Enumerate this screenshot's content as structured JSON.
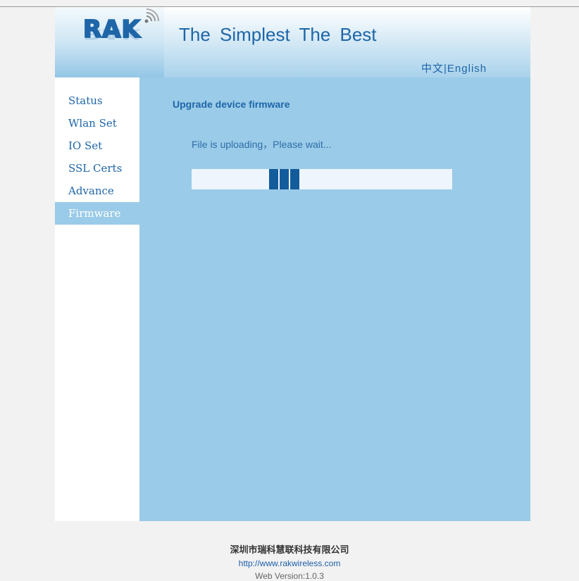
{
  "header": {
    "logo_text": "RAK",
    "slogan": "The Simplest The Best",
    "lang_zh": "中文",
    "lang_sep": "|",
    "lang_en": "English"
  },
  "sidebar": {
    "items": [
      {
        "label": "Status",
        "active": false
      },
      {
        "label": "Wlan Set",
        "active": false
      },
      {
        "label": "IO Set",
        "active": false
      },
      {
        "label": "SSL Certs",
        "active": false
      },
      {
        "label": "Advance",
        "active": false
      },
      {
        "label": "Firmware",
        "active": true
      }
    ]
  },
  "main": {
    "title": "Upgrade device firmware",
    "status": "File is uploading，Please wait..."
  },
  "footer": {
    "company": "深圳市瑞科慧联科技有限公司",
    "url": "http://www.rakwireless.com",
    "version": "Web Version:1.0.3"
  },
  "colors": {
    "brand": "#1e66a8",
    "panel": "#9acbe8",
    "progress_block": "#135c9c"
  }
}
